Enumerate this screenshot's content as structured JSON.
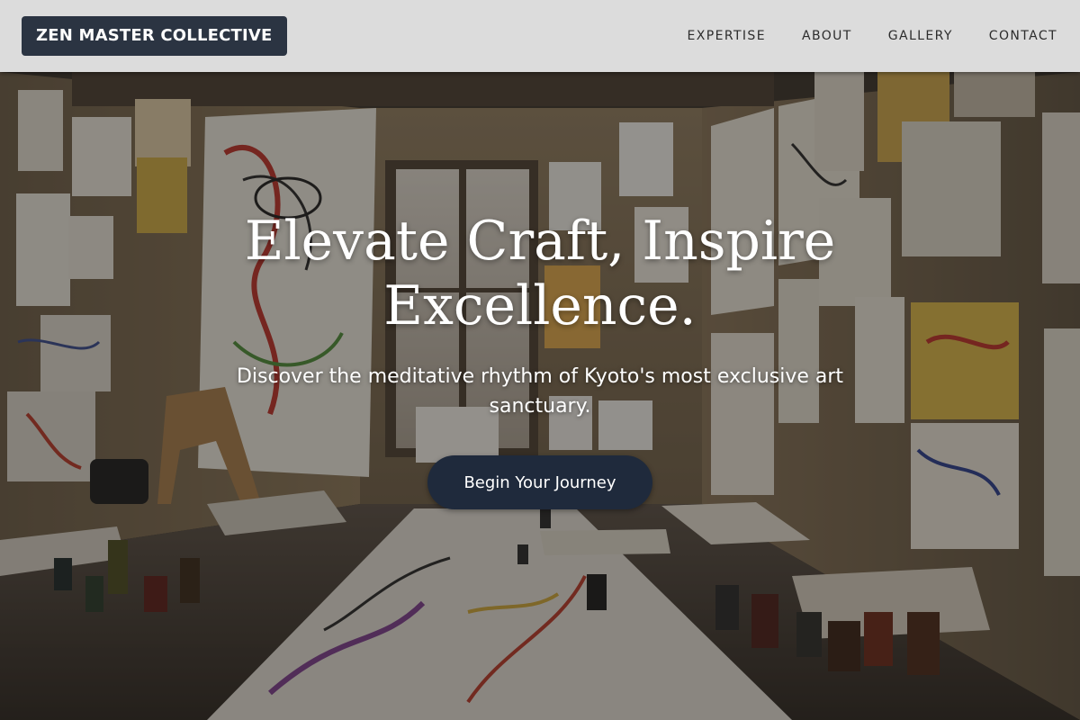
{
  "header": {
    "logo_text": "ZEN MASTER COLLECTIVE",
    "nav": [
      "EXPERTISE",
      "ABOUT",
      "GALLERY",
      "CONTACT"
    ]
  },
  "hero": {
    "headline": "Elevate Craft, Inspire Excellence.",
    "subheadline": "Discover the meditative rhythm of Kyoto's most exclusive art sanctuary.",
    "cta_label": "Begin Your Journey",
    "background_image": "art-studio-photo"
  },
  "colors": {
    "header_bg": "#dcdcdc",
    "logo_bg": "#2b3442",
    "cta_bg": "#1f2a3c",
    "nav_text": "#2c2c2c",
    "hero_text": "#ffffff"
  }
}
